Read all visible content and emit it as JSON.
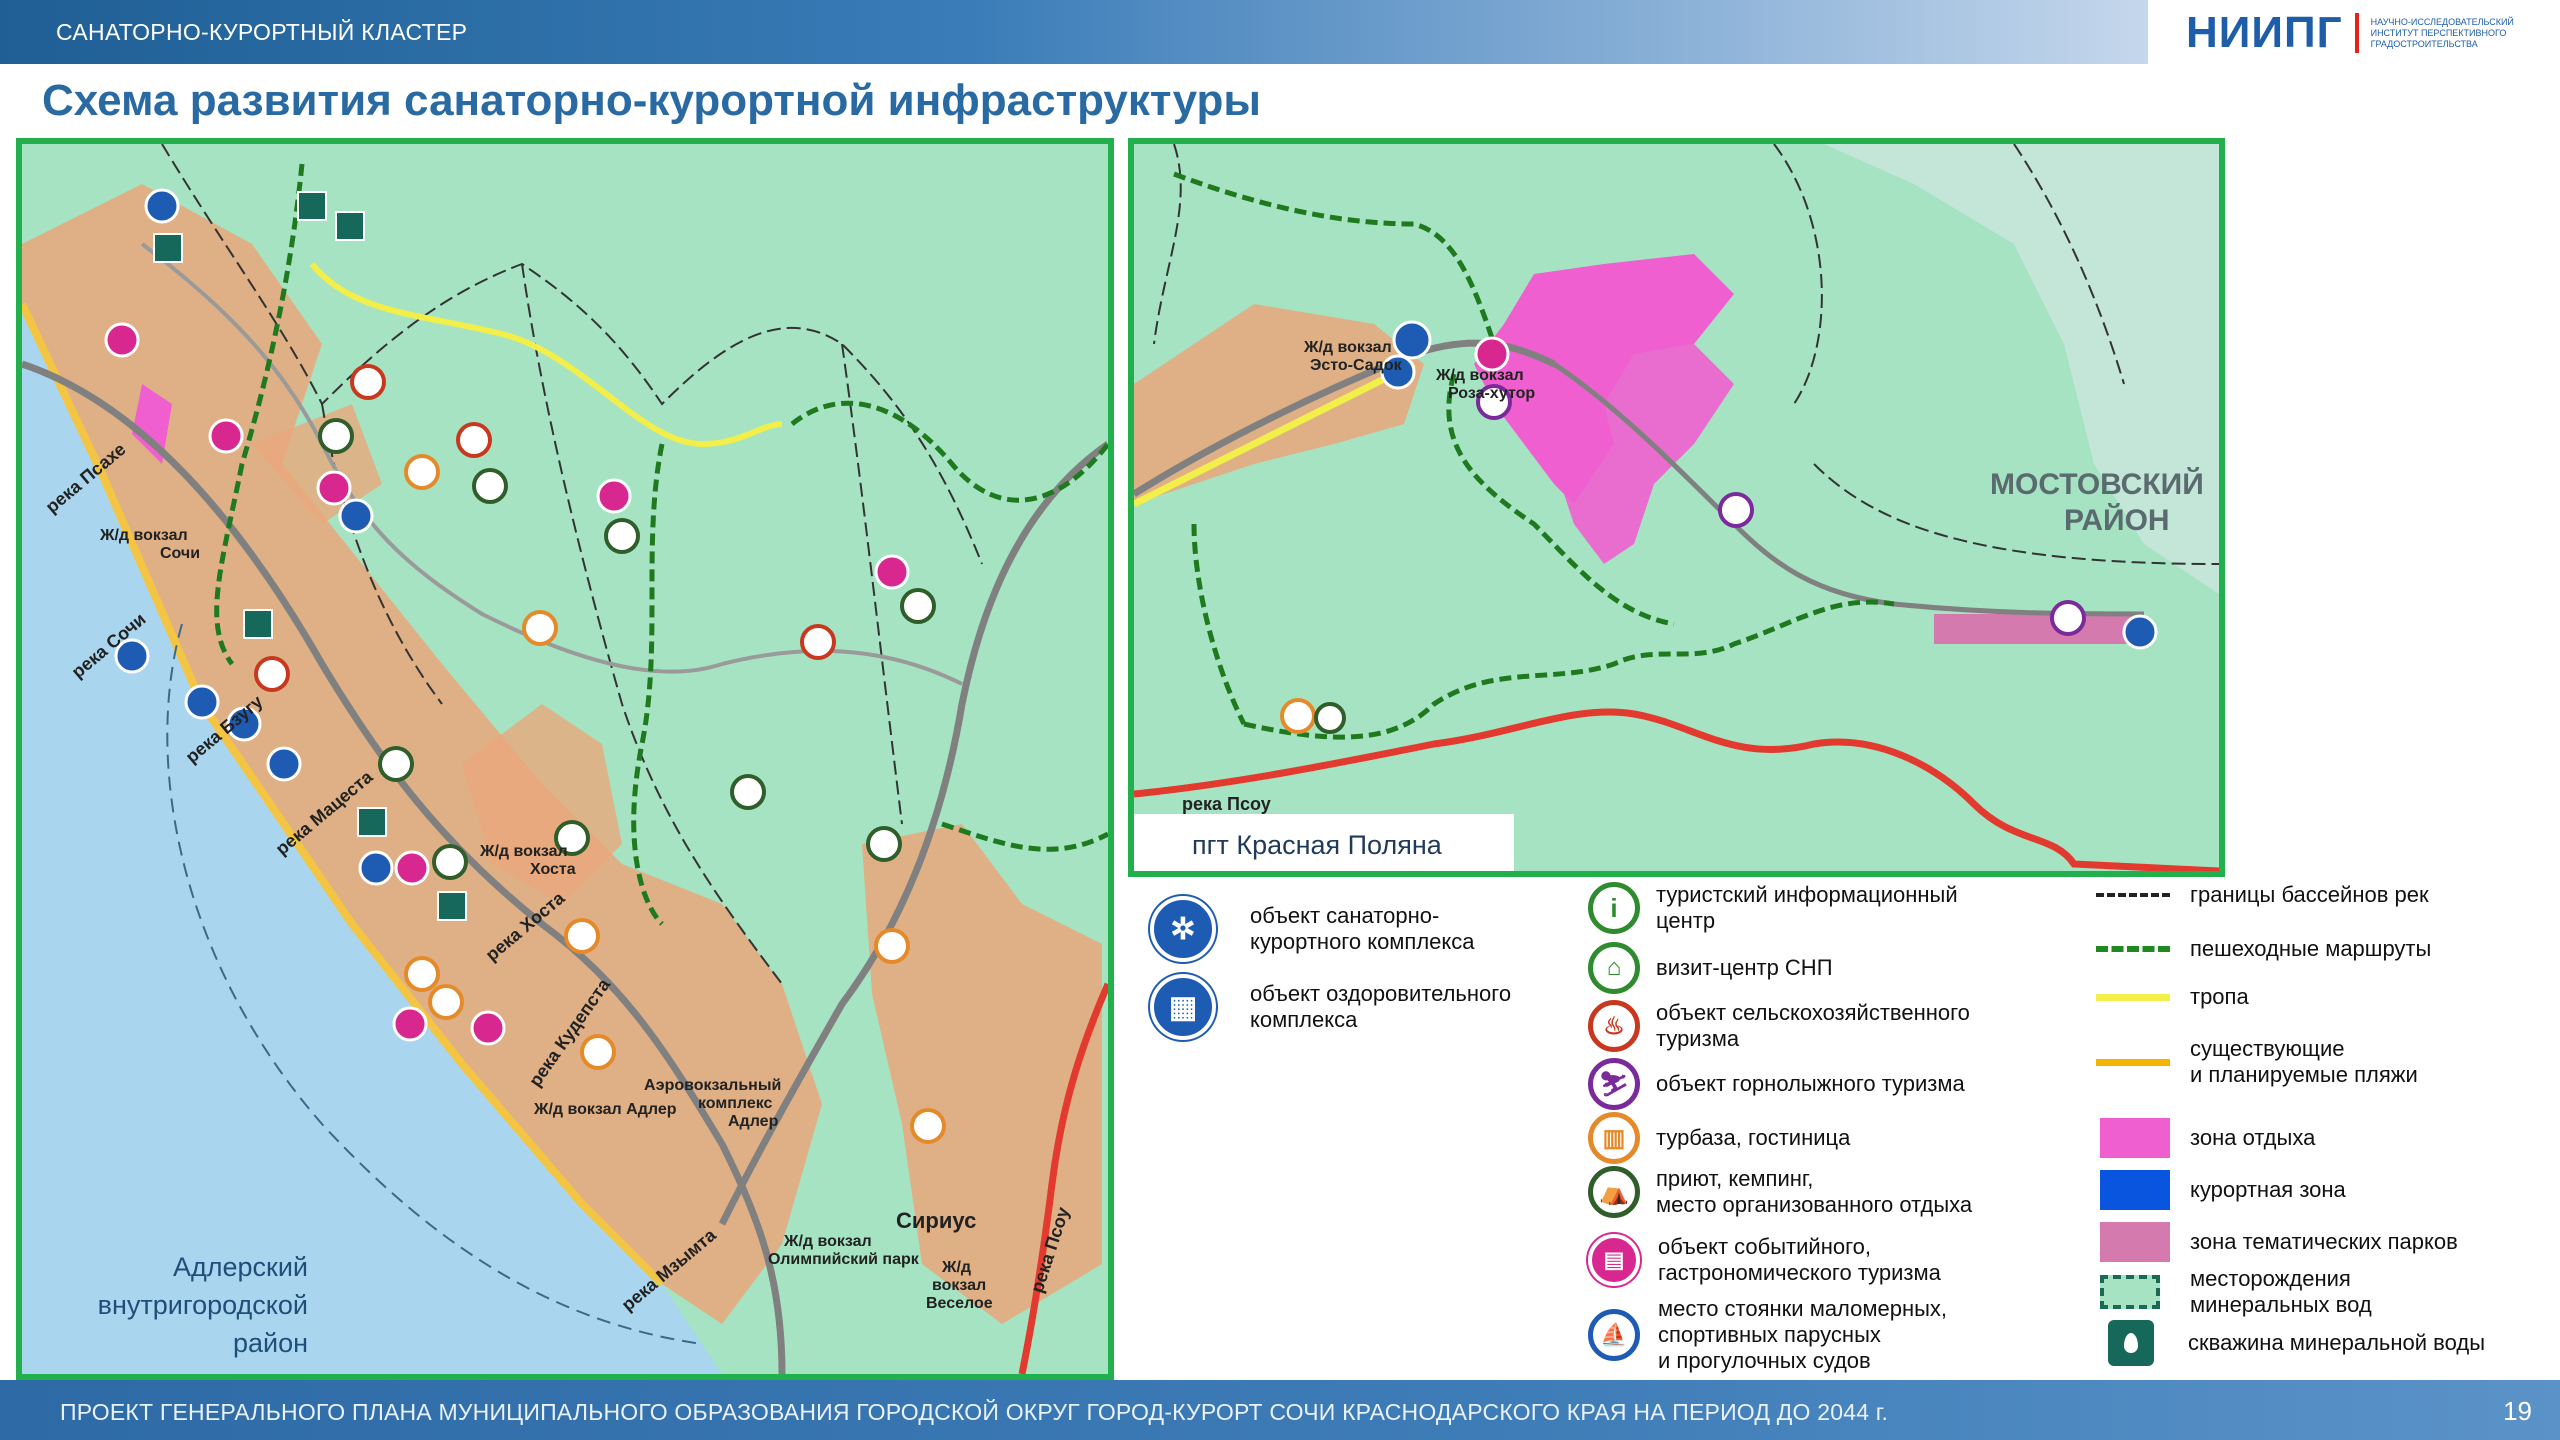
{
  "header": {
    "cluster_label": "САНАТОРНО-КУРОРТНЫЙ КЛАСТЕР",
    "logo_main": "НИИПГ",
    "logo_sub": "НАУЧНО-ИССЛЕДОВАТЕЛЬСКИЙ ИНСТИТУТ ПЕРСПЕКТИВНОГО ГРАДОСТРОИТЕЛЬСТВА"
  },
  "title": "Схема развития санаторно-курортной инфраструктуры",
  "map_left": {
    "district": "Адлерский внутригородской район",
    "district_lines": [
      "Адлерский",
      "внутригородской",
      "район"
    ],
    "labels": {
      "psakhe": "река Псахе",
      "sochi_river": "река Сочи",
      "bzugu": "река Бзугу",
      "matsesta": "река Мацеста",
      "khosta_river": "река Хоста",
      "kudepsta": "река Кудепста",
      "mzymta": "река Мзымта",
      "psou": "река Псоу",
      "station_sochi_1": "Ж/д вокзал",
      "station_sochi_2": "Сочи",
      "station_khosta_1": "Ж/д вокзал",
      "station_khosta_2": "Хоста",
      "airport_1": "Аэровокзальный",
      "airport_2": "комплекс",
      "airport_3": "Адлер",
      "station_adler": "Ж/д вокзал Адлер",
      "station_olymp_1": "Ж/д вокзал",
      "station_olymp_2": "Олимпийский парк",
      "sirius": "Сириус",
      "station_vesel_1": "Ж/д",
      "station_vesel_2": "вокзал",
      "station_vesel_3": "Веселое"
    }
  },
  "map_right": {
    "caption": "пгт Красная Поляна",
    "labels": {
      "esto_1": "Ж/д вокзал",
      "esto_2": "Эсто-Садок",
      "roza_1": "Ж/д вокзал",
      "roza_2": "Роза-хутор",
      "mostovsky_1": "МОСТОВСКИЙ",
      "mostovsky_2": "РАЙОН",
      "psou": "река Псоу"
    }
  },
  "legend": {
    "col1": [
      {
        "icon": "sanatorium-icon",
        "color": "#1e5cb3",
        "text": "объект санаторно-курортного комплекса",
        "lines": [
          "объект санаторно-",
          "курортного комплекса"
        ]
      },
      {
        "icon": "health-complex-icon",
        "color": "#1e5cb3",
        "text": "объект оздоровительного комплекса",
        "lines": [
          "объект оздоровительного",
          "комплекса"
        ]
      }
    ],
    "col2": [
      {
        "icon": "info-icon",
        "color": "#2e8b2e",
        "lines": [
          "туристский информационный",
          "центр"
        ]
      },
      {
        "icon": "visit-center-icon",
        "color": "#2e8b2e",
        "lines": [
          "визит-центр СНП"
        ]
      },
      {
        "icon": "agro-tourism-icon",
        "color": "#c8381f",
        "lines": [
          "объект сельскохозяйственного",
          "туризма"
        ]
      },
      {
        "icon": "ski-icon",
        "color": "#7a2a9a",
        "lines": [
          "объект горнолыжного туризма"
        ]
      },
      {
        "icon": "hotel-icon",
        "color": "#e58a2a",
        "lines": [
          "турбаза, гостиница"
        ]
      },
      {
        "icon": "camping-icon",
        "color": "#2f5e2a",
        "lines": [
          "приют, кемпинг,",
          "место организованного отдыха"
        ]
      },
      {
        "icon": "event-icon",
        "color": "#d8288f",
        "lines": [
          "объект событийного,",
          "гастрономического туризма"
        ]
      },
      {
        "icon": "boat-icon",
        "color": "#1e5cb3",
        "lines": [
          "место стоянки маломерных,",
          "спортивных парусных",
          "и прогулочных судов"
        ]
      }
    ],
    "col3": [
      {
        "sample": "river-basin-border-line",
        "lines": [
          "границы бассейнов рек"
        ]
      },
      {
        "sample": "walking-route-line",
        "lines": [
          "пешеходные маршруты"
        ]
      },
      {
        "sample": "trail-line",
        "lines": [
          "тропа"
        ]
      },
      {
        "sample": "beach-line",
        "lines": [
          "существующие",
          "и планируемые пляжи"
        ]
      },
      {
        "sample": "recreation-zone-swatch",
        "color": "#f05fcf",
        "lines": [
          "зона отдыха"
        ]
      },
      {
        "sample": "resort-zone-swatch",
        "color": "#0a55e0",
        "lines": [
          "курортная зона"
        ]
      },
      {
        "sample": "theme-park-swatch",
        "color": "#d47aae",
        "lines": [
          "зона тематических парков"
        ]
      },
      {
        "sample": "mineral-deposit-swatch",
        "lines": [
          "месторождения",
          "минеральных вод"
        ]
      },
      {
        "sample": "mineral-well-icon",
        "lines": [
          "скважина минеральной воды"
        ]
      }
    ]
  },
  "footer": {
    "text": "ПРОЕКТ ГЕНЕРАЛЬНОГО ПЛАНА  МУНИЦИПАЛЬНОГО ОБРАЗОВАНИЯ ГОРОДСКОЙ ОКРУГ ГОРОД-КУРОРТ СОЧИ КРАСНОДАРСКОГО КРАЯ НА ПЕРИОД ДО 2044 г.",
    "page": "19"
  },
  "colors": {
    "frame": "#21b04b",
    "land": "#a6e3c3",
    "sea": "#a9d6ee",
    "urban": "#e9a77b",
    "recreation": "#f05fcf",
    "title": "#2a6aa3"
  }
}
